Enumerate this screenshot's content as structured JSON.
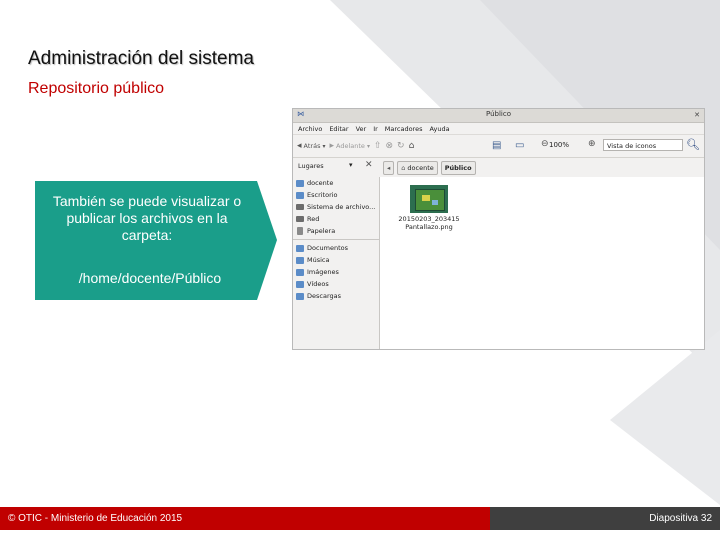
{
  "slide": {
    "title": "Administración del sistema",
    "subtitle": "Repositorio público"
  },
  "callout": {
    "text": "También se puede visualizar o publicar los archivos en la carpeta:",
    "path": "/home/docente/Público",
    "color": "#1a9e8a"
  },
  "file_manager": {
    "window_title": "Público",
    "menu": [
      "Archivo",
      "Editar",
      "Ver",
      "Ir",
      "Marcadores",
      "Ayuda"
    ],
    "toolbar": {
      "back_label": "Atrás",
      "forward_label": "Adelante",
      "zoom": "100%",
      "view_mode": "Vista de iconos"
    },
    "sidebar_header": "Lugares",
    "path_buttons": [
      "docente",
      "Público"
    ],
    "places": [
      {
        "label": "docente",
        "icon": "folder-icon"
      },
      {
        "label": "Escritorio",
        "icon": "folder-icon"
      },
      {
        "label": "Sistema de archivo...",
        "icon": "drive-icon"
      },
      {
        "label": "Red",
        "icon": "drive-icon"
      },
      {
        "label": "Papelera",
        "icon": "trash-icon"
      }
    ],
    "bookmarks": [
      "Documentos",
      "Música",
      "Imágenes",
      "Vídeos",
      "Descargas"
    ],
    "files": [
      {
        "name_line1": "20150203_203415",
        "name_line2": "Pantallazo.png"
      }
    ]
  },
  "footer": {
    "left": "© OTIC - Ministerio de Educación 2015",
    "right": "Diapositiva 32"
  }
}
